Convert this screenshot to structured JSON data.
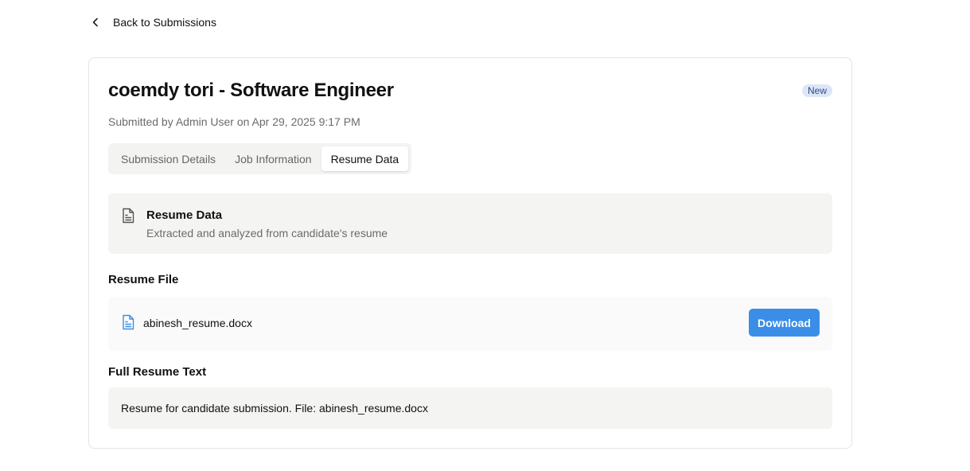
{
  "nav": {
    "back_label": "Back to Submissions"
  },
  "header": {
    "title": "coemdy tori - Software Engineer",
    "status_badge": "New",
    "subtitle": "Submitted by Admin User on Apr 29, 2025 9:17 PM"
  },
  "tabs": [
    {
      "label": "Submission Details",
      "active": false
    },
    {
      "label": "Job Information",
      "active": false
    },
    {
      "label": "Resume Data",
      "active": true
    }
  ],
  "resume_panel": {
    "title": "Resume Data",
    "description": "Extracted and analyzed from candidate's resume",
    "icon": "file-text-icon"
  },
  "resume_file": {
    "section_title": "Resume File",
    "file_name": "abinesh_resume.docx",
    "icon": "file-icon",
    "download_label": "Download"
  },
  "full_text": {
    "section_title": "Full Resume Text",
    "content": "Resume for candidate submission. File: abinesh_resume.docx"
  },
  "colors": {
    "accent": "#3b8ee8",
    "badge_bg": "#dde6f6",
    "badge_text": "#2b4a8f",
    "panel_bg": "#f4f4f3"
  }
}
